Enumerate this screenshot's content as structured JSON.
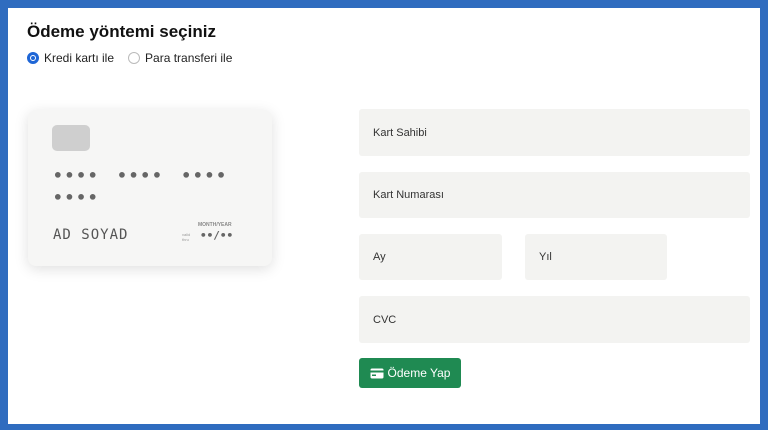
{
  "header": {
    "title": "Ödeme yöntemi seçiniz"
  },
  "payment_methods": [
    {
      "label": "Kredi kartı ile",
      "selected": true
    },
    {
      "label": "Para transferi ile",
      "selected": false
    }
  ],
  "card_preview": {
    "number": "•••• •••• •••• ••••",
    "holder": "AD SOYAD",
    "month_year_label": "MONTH/YEAR",
    "valid_thru_label": "valid thru",
    "expiry": "••/••"
  },
  "form": {
    "owner_placeholder": "Kart Sahibi",
    "number_placeholder": "Kart Numarası",
    "month_placeholder": "Ay",
    "year_placeholder": "Yıl",
    "cvc_placeholder": "CVC",
    "submit_label": "Ödeme Yap",
    "submit_icon": "credit-card-icon"
  },
  "colors": {
    "accent": "#1f66d6",
    "button": "#1f8a52",
    "frame": "#2f6cbf"
  }
}
